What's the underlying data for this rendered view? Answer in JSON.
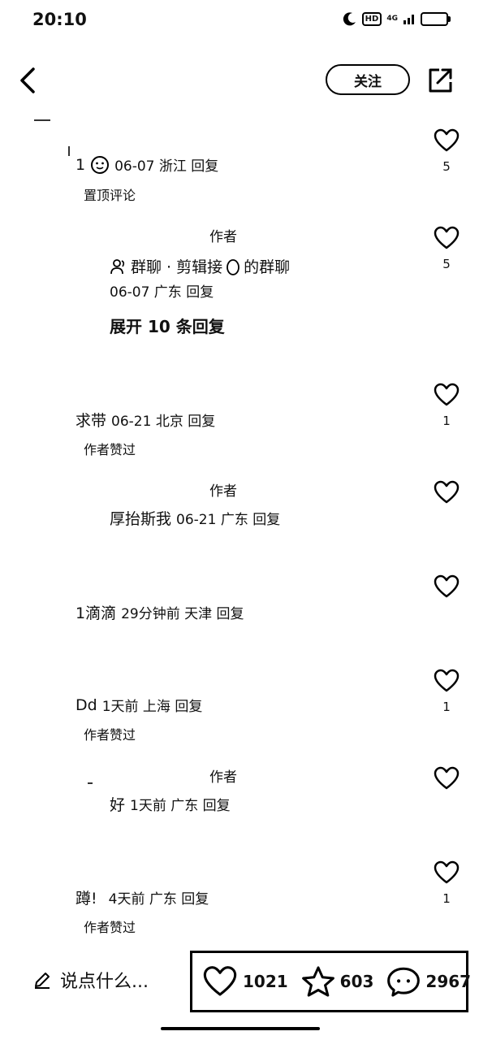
{
  "status": {
    "time": "20:10",
    "hd": "HD",
    "network": "4G"
  },
  "header": {
    "follow_label": "关注"
  },
  "comments": [
    {
      "name": "1",
      "meta": "06-07 浙江 回复",
      "tag": "置顶评论",
      "likes": "5",
      "reply": {
        "author_label": "作者",
        "name": "群聊 · 剪辑接",
        "name_suffix": "的群聊",
        "meta": "06-07 广东 回复",
        "likes": "5"
      },
      "expand": "展开 10 条回复"
    },
    {
      "name": "求带",
      "meta": "06-21 北京 回复",
      "tag": "作者赞过",
      "likes": "1",
      "reply": {
        "author_label": "作者",
        "name": "厚抬斯我",
        "meta": "06-21 广东 回复"
      }
    },
    {
      "name": "1滴滴",
      "meta": "29分钟前  天津 回复"
    },
    {
      "name": "Dd",
      "meta": "1天前  上海 回复",
      "tag": "作者赞过",
      "likes": "1",
      "reply": {
        "author_label": "作者",
        "name": "好",
        "meta": "1天前  广东 回复"
      }
    },
    {
      "name": "蹲!",
      "meta": "4天前  广东 回复",
      "tag": "作者赞过",
      "likes": "1"
    }
  ],
  "bottom": {
    "input_placeholder": "说点什么...",
    "likes": "1021",
    "favorites": "603",
    "comments": "2967"
  }
}
